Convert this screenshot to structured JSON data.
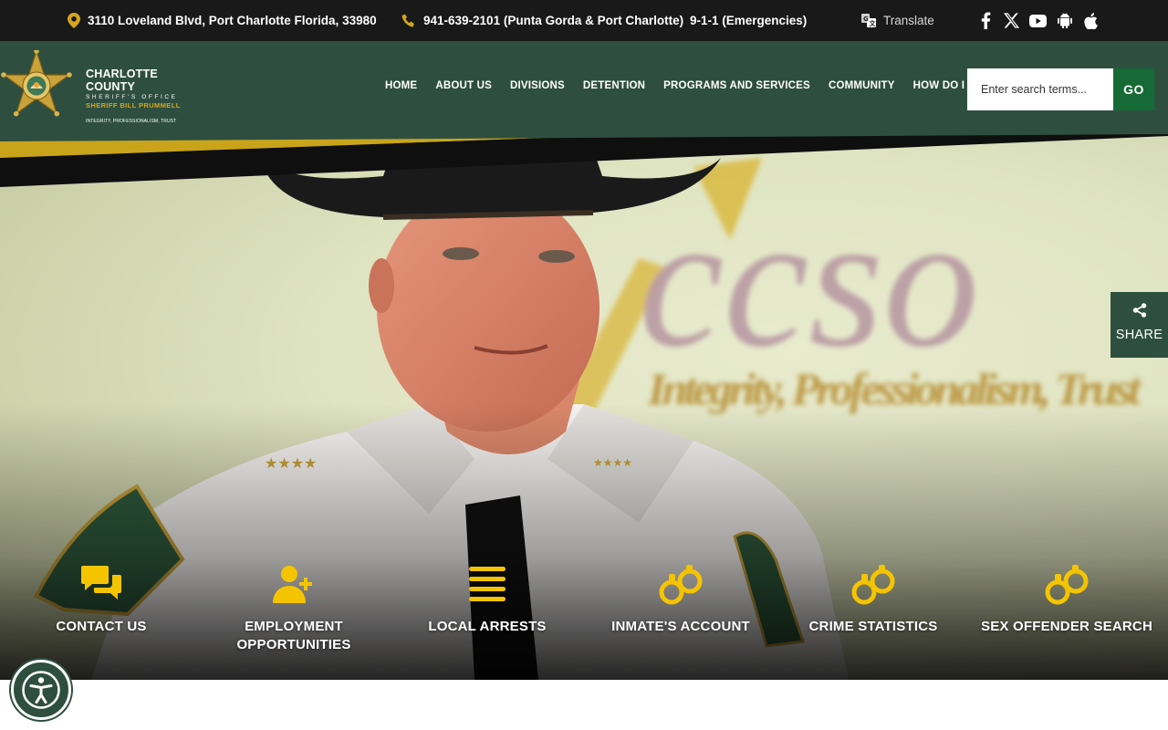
{
  "topbar": {
    "address": "3110 Loveland Blvd, Port Charlotte Florida, 33980",
    "phone": "941-639-2101 (Punta Gorda & Port Charlotte)",
    "emergency": "9-1-1 (Emergencies)",
    "translate": "Translate",
    "social_icons": [
      "facebook-icon",
      "x-icon",
      "youtube-icon",
      "android-icon",
      "apple-icon"
    ]
  },
  "logo": {
    "line1": "CHARLOTTE COUNTY",
    "line2": "SHERIFF'S OFFICE",
    "line3": "SHERIFF BILL PRUMMELL",
    "motto": "INTEGRITY, PROFESSIONALISM, TRUST"
  },
  "nav": {
    "items": [
      "HOME",
      "ABOUT US",
      "DIVISIONS",
      "DETENTION",
      "PROGRAMS AND SERVICES",
      "COMMUNITY",
      "HOW DO I"
    ]
  },
  "search": {
    "placeholder": "Enter search terms...",
    "button": "GO"
  },
  "hero": {
    "wall_text": "ccso",
    "wall_tagline": "Integrity, Professionalism, Trust"
  },
  "quick_links": [
    {
      "label": "CONTACT US",
      "icon": "chat-bubbles-icon"
    },
    {
      "label": "EMPLOYMENT OPPORTUNITIES",
      "icon": "user-plus-icon"
    },
    {
      "label": "LOCAL ARRESTS",
      "icon": "list-lines-icon"
    },
    {
      "label": "INMATE'S ACCOUNT",
      "icon": "handcuffs-icon"
    },
    {
      "label": "CRIME STATISTICS",
      "icon": "handcuffs-icon"
    },
    {
      "label": "SEX OFFENDER SEARCH",
      "icon": "handcuffs-icon"
    }
  ],
  "share": {
    "label": "SHARE"
  },
  "colors": {
    "topbar": "#191919",
    "header_green": "#2e4f3f",
    "gold": "#d4a520",
    "go_button": "#166a35",
    "icon_yellow": "#f5c400"
  }
}
